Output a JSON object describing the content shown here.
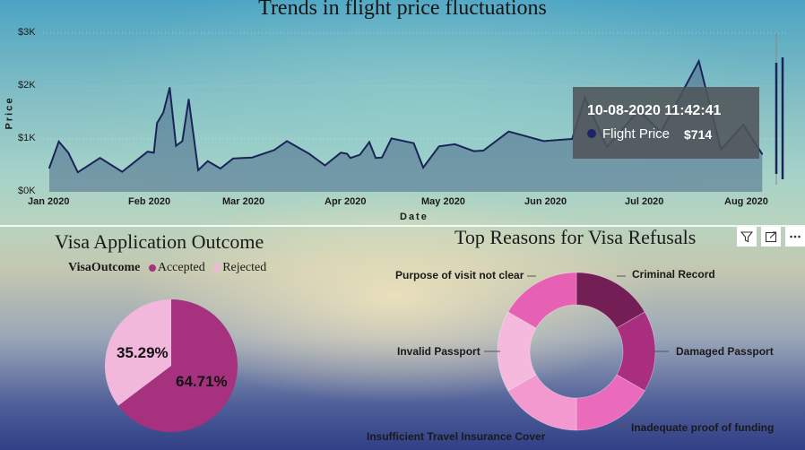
{
  "line": {
    "title": "Trends in flight price fluctuations",
    "xlabel": "Date",
    "ylabel": "Price",
    "yticks": [
      "$0K",
      "$1K",
      "$2K",
      "$3K"
    ],
    "xticks": [
      "Jan 2020",
      "Feb 2020",
      "Mar 2020",
      "Apr 2020",
      "May 2020",
      "Jun 2020",
      "Jul 2020",
      "Aug 2020"
    ],
    "colors": {
      "line": "#1b2458",
      "fill": "#4a6a8a"
    }
  },
  "tooltip": {
    "date": "10-08-2020 11:42:41",
    "series": "Flight Price",
    "value": "$714"
  },
  "pie": {
    "title": "Visa Application Outcome",
    "legend_title": "VisaOutcome",
    "accepted_label": "Accepted",
    "rejected_label": "Rejected",
    "accepted_pct": "64.71%",
    "rejected_pct": "35.29%",
    "colors": {
      "accepted": "#a6317e",
      "rejected": "#f2b8dc"
    }
  },
  "donut": {
    "title": "Top Reasons for Visa Refusals",
    "labels": {
      "criminal": "Criminal Record",
      "damaged": "Damaged Passport",
      "funding": "Inadequate proof of funding",
      "insurance": "Insufficient Travel Insurance Cover",
      "invalid": "Invalid Passport",
      "purpose": "Purpose of visit not clear"
    }
  },
  "chart_data": [
    {
      "type": "line",
      "title": "Trends in flight price fluctuations",
      "xlabel": "Date",
      "ylabel": "Price",
      "ylim": [
        0,
        3000
      ],
      "xlim": [
        "2020-01-01",
        "2020-08-20"
      ],
      "grid": true,
      "x": [
        "2020-01-01",
        "2020-01-04",
        "2020-01-07",
        "2020-01-10",
        "2020-01-17",
        "2020-01-24",
        "2020-02-01",
        "2020-02-03",
        "2020-02-04",
        "2020-02-06",
        "2020-02-08",
        "2020-02-10",
        "2020-02-12",
        "2020-02-14",
        "2020-02-17",
        "2020-02-20",
        "2020-02-24",
        "2020-02-28",
        "2020-03-02",
        "2020-03-05",
        "2020-03-12",
        "2020-03-16",
        "2020-03-23",
        "2020-03-28",
        "2020-04-02",
        "2020-04-04",
        "2020-04-05",
        "2020-04-08",
        "2020-04-11",
        "2020-04-13",
        "2020-04-15",
        "2020-04-18",
        "2020-04-25",
        "2020-04-28",
        "2020-05-03",
        "2020-05-08",
        "2020-05-14",
        "2020-05-17",
        "2020-05-25",
        "2020-06-05",
        "2020-06-14",
        "2020-06-18",
        "2020-06-25",
        "2020-07-05",
        "2020-07-12",
        "2020-07-24",
        "2020-07-31",
        "2020-08-07",
        "2020-08-10",
        "2020-08-13"
      ],
      "values": [
        450,
        950,
        740,
        370,
        640,
        380,
        760,
        740,
        1300,
        1500,
        1970,
        870,
        960,
        1750,
        410,
        580,
        440,
        630,
        640,
        650,
        790,
        960,
        720,
        500,
        740,
        720,
        640,
        700,
        940,
        640,
        650,
        1010,
        920,
        460,
        860,
        900,
        770,
        780,
        1140,
        960,
        1000,
        1780,
        850,
        1540,
        1130,
        2470,
        800,
        1270,
        990,
        714
      ],
      "annotations": [
        {
          "x": "2020-08-10",
          "label": "10-08-2020 11:42:41",
          "value": "$714"
        }
      ]
    },
    {
      "type": "pie",
      "title": "Visa Application Outcome",
      "labels": [
        "Accepted",
        "Rejected"
      ],
      "values": [
        64.71,
        35.29
      ],
      "legend": "top"
    },
    {
      "type": "pie",
      "title": "Top Reasons for Visa Refusals",
      "labels": [
        "Criminal Record",
        "Damaged Passport",
        "Inadequate proof of funding",
        "Insufficient Travel Insurance Cover",
        "Invalid Passport",
        "Purpose of visit not clear"
      ],
      "values": [
        16.67,
        16.67,
        16.67,
        16.67,
        16.67,
        16.67
      ],
      "colors": [
        "#731e55",
        "#a92e80",
        "#ea6bbb",
        "#f29ad0",
        "#f4b9dd",
        "#e661b4"
      ]
    }
  ]
}
